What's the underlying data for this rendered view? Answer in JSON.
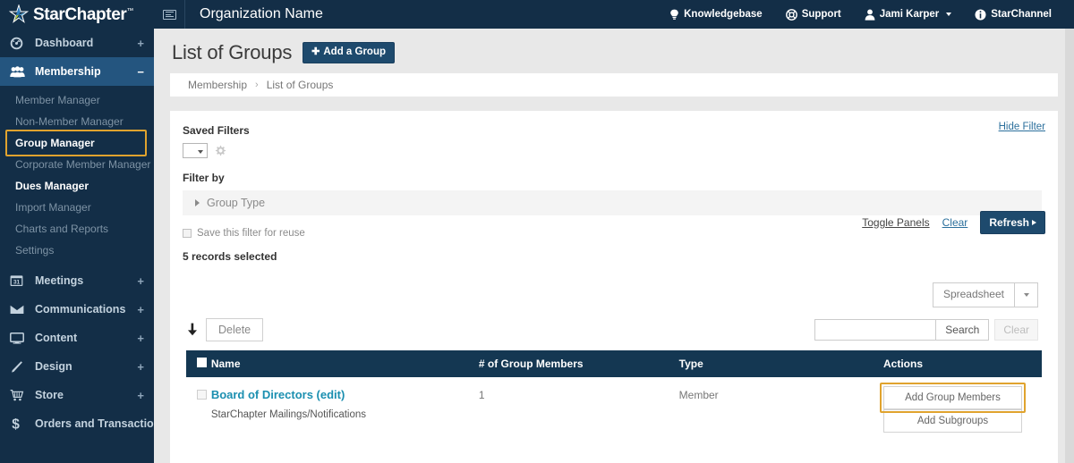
{
  "topbar": {
    "brand": "StarChapter",
    "brand_tm": "™",
    "org_name": "Organization Name",
    "menu_toggle_icon": "menu-toggle-icon",
    "items": [
      {
        "label": "Knowledgebase",
        "icon": "lightbulb-icon"
      },
      {
        "label": "Support",
        "icon": "lifering-icon"
      },
      {
        "label": "Jami Karper",
        "icon": "user-icon",
        "has_caret": true
      },
      {
        "label": "StarChannel",
        "icon": "info-icon"
      }
    ]
  },
  "sidebar": {
    "groups": [
      {
        "label": "Dashboard",
        "icon": "gauge-icon",
        "expander": "+",
        "active": false
      },
      {
        "label": "Membership",
        "icon": "people-icon",
        "expander": "−",
        "active": true
      }
    ],
    "membership_items": [
      {
        "label": "Member Manager",
        "style": "normal"
      },
      {
        "label": "Non-Member Manager",
        "style": "normal"
      },
      {
        "label": "Group Manager",
        "style": "highlighted"
      },
      {
        "label": "Corporate Member Manager",
        "style": "normal"
      },
      {
        "label": "Dues Manager",
        "style": "strong"
      },
      {
        "label": "Import Manager",
        "style": "normal"
      },
      {
        "label": "Charts and Reports",
        "style": "normal"
      },
      {
        "label": "Settings",
        "style": "normal"
      }
    ],
    "lower_groups": [
      {
        "label": "Meetings",
        "icon": "calendar-31-icon",
        "expander": "+"
      },
      {
        "label": "Communications",
        "icon": "envelope-icon",
        "expander": "+"
      },
      {
        "label": "Content",
        "icon": "monitor-icon",
        "expander": "+"
      },
      {
        "label": "Design",
        "icon": "pencil-icon",
        "expander": "+"
      },
      {
        "label": "Store",
        "icon": "cart-icon",
        "expander": "+"
      },
      {
        "label": "Orders and Transactions",
        "icon": "dollar-icon",
        "expander": "+"
      }
    ]
  },
  "page": {
    "title": "List of Groups",
    "add_group_button": "Add a Group",
    "add_group_plus": "✚",
    "breadcrumb": [
      "Membership",
      "List of Groups"
    ],
    "breadcrumb_sep": "›"
  },
  "filter": {
    "saved_filters_label": "Saved Filters",
    "hide_filter_link": "Hide Filter",
    "saved_filter_value": "",
    "gear_icon": "gear-icon",
    "filter_by_label": "Filter by",
    "group_type_label": "Group Type",
    "save_for_reuse_label": "Save this filter for reuse",
    "save_for_reuse_checked": false,
    "toggle_panels_link": "Toggle Panels",
    "clear_link": "Clear",
    "refresh_button": "Refresh",
    "records_selected": "5 records selected"
  },
  "export": {
    "spreadsheet_button": "Spreadsheet",
    "dropdown_icon": "chevron-down-icon"
  },
  "toolbar": {
    "down_arrow_icon": "arrow-down-icon",
    "delete_button": "Delete",
    "search_value": "",
    "search_placeholder": "",
    "search_button": "Search",
    "clear_button": "Clear"
  },
  "table": {
    "columns": [
      "Name",
      "# of Group Members",
      "Type",
      "Actions"
    ],
    "rows": [
      {
        "name": "Board of Directors (edit)",
        "subtitle": "StarChapter Mailings/Notifications",
        "members": "1",
        "type": "Member",
        "actions": [
          {
            "label": "Add Group Members",
            "highlighted": true
          },
          {
            "label": "Add Subgroups",
            "highlighted": false
          }
        ]
      }
    ]
  },
  "colors": {
    "navy": "#132e47",
    "navy_active": "#24557f",
    "table_header": "#143752",
    "accent_gold": "#e0a32e",
    "link_blue": "#2b6f9c",
    "name_link": "#1b8fb0",
    "button_blue": "#1e4a6d"
  }
}
